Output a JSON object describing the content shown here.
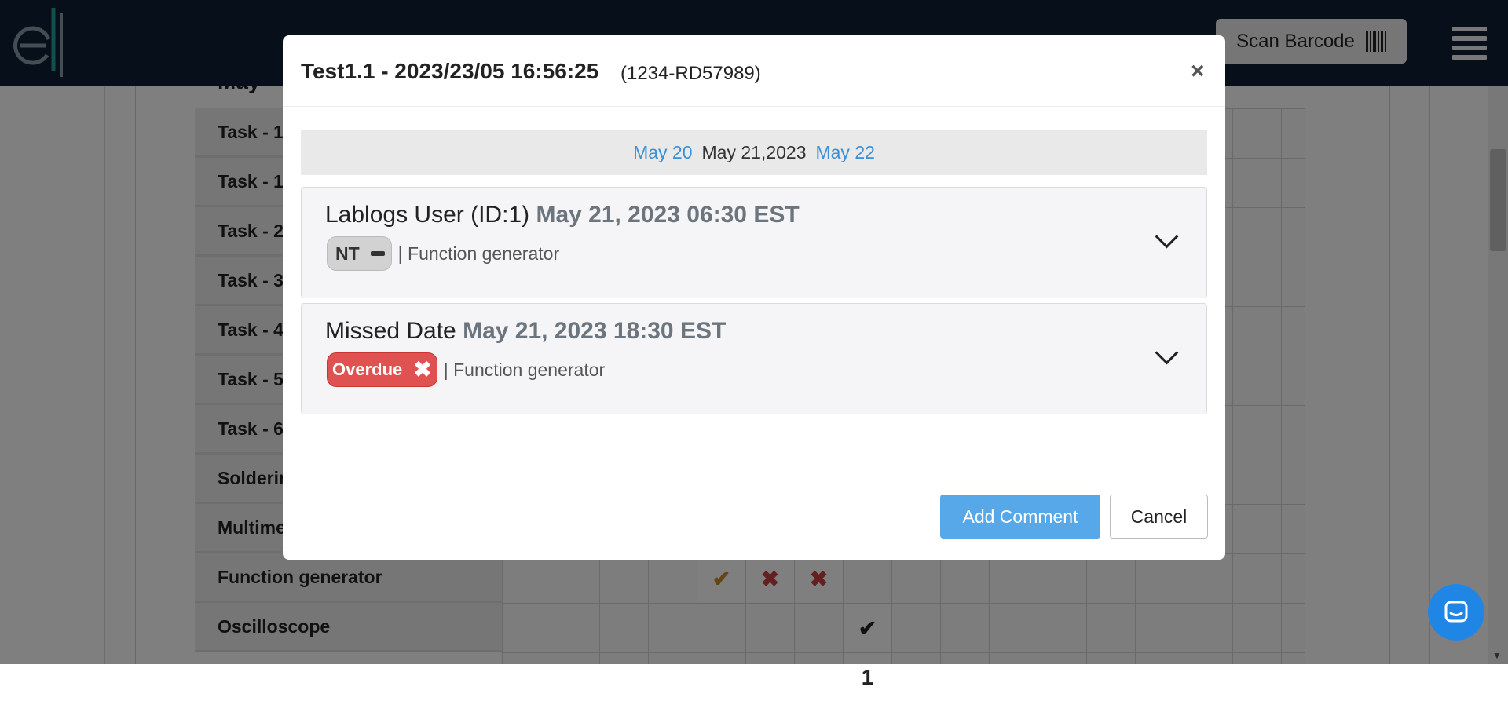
{
  "nav": {
    "scan_label": "Scan Barcode",
    "logo_text": "e|"
  },
  "calendar": {
    "month_label": "May",
    "tasks": [
      "Task - 1",
      "Task - 1",
      "Task - 2",
      "Task - 3",
      "Task - 4",
      "Task - 5",
      "Task - 6",
      "Soldering",
      "Multimeter",
      "Function generator",
      "Oscilloscope"
    ],
    "marks": [
      {
        "row": 9,
        "col": 4,
        "symbol": "✔",
        "color": "#c98a2a"
      },
      {
        "row": 9,
        "col": 5,
        "symbol": "✖",
        "color": "#c84040"
      },
      {
        "row": 9,
        "col": 6,
        "symbol": "✖",
        "color": "#c84040"
      },
      {
        "row": 10,
        "col": 7,
        "symbol": "✔",
        "color": "#222222"
      },
      {
        "row": 11,
        "col": 7,
        "symbol": "1",
        "color": "#222222"
      }
    ]
  },
  "modal": {
    "title": "Test1.1 - 2023/23/05 16:56:25",
    "subtitle": "(1234-RD57989)",
    "close_label": "×",
    "date_nav": {
      "prev": "May 20",
      "current": "May 21,2023",
      "next": "May 22"
    },
    "entries": [
      {
        "user": "Lablogs User (ID:1)",
        "timestamp": "May 21, 2023 06:30 EST",
        "badge": "NT",
        "equipment": "| Function generator"
      },
      {
        "user": "Missed Date",
        "timestamp": "May 21, 2023 18:30 EST",
        "badge": "Overdue",
        "equipment": "| Function generator"
      }
    ],
    "add_comment_label": "Add Comment",
    "cancel_label": "Cancel"
  },
  "colors": {
    "navbar": "#0f2034",
    "accent": "#57a8e8",
    "overdue": "#e05252",
    "link": "#3a8fd6"
  }
}
